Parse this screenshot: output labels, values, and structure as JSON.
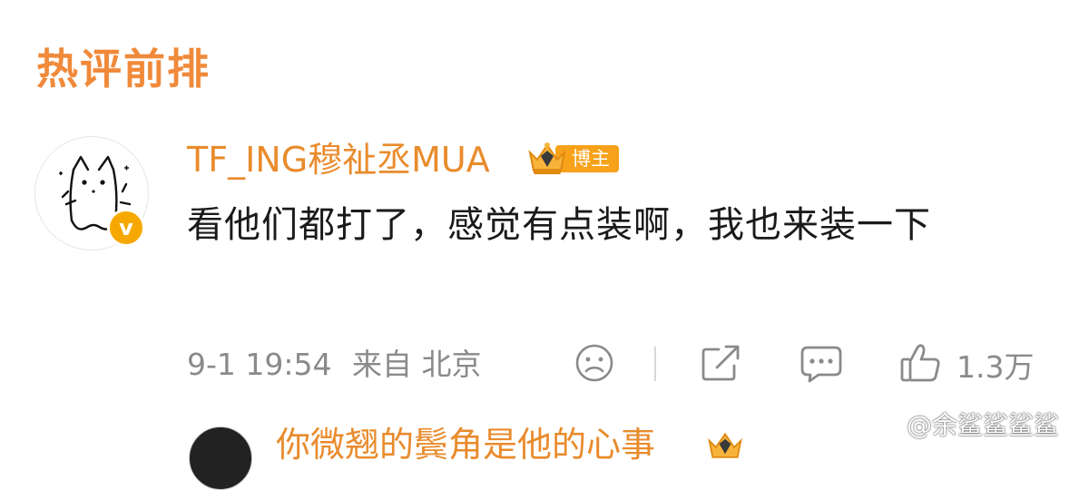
{
  "section": {
    "title": "热评前排"
  },
  "comment": {
    "username": "TF_ING穆祉丞MUA",
    "badge_label": "博主",
    "verified_mark": "v",
    "text": "看他们都打了，感觉有点装啊，我也来装一下",
    "timestamp": "9-1 19:54",
    "location": "来自 北京",
    "like_count": "1.3万",
    "icons": [
      "sad-face-icon",
      "share-icon",
      "comment-icon",
      "thumbs-up-icon"
    ]
  },
  "reply": {
    "username": "你微翘的鬓角是他的心事"
  },
  "watermark": {
    "text": "@余鲨鲨鲨鲨"
  },
  "colors": {
    "accent": "#f08a3a",
    "username": "#e98b2c",
    "badge": "#f7a21a",
    "text": "#1a1a1a",
    "meta": "#8a8a8a"
  }
}
